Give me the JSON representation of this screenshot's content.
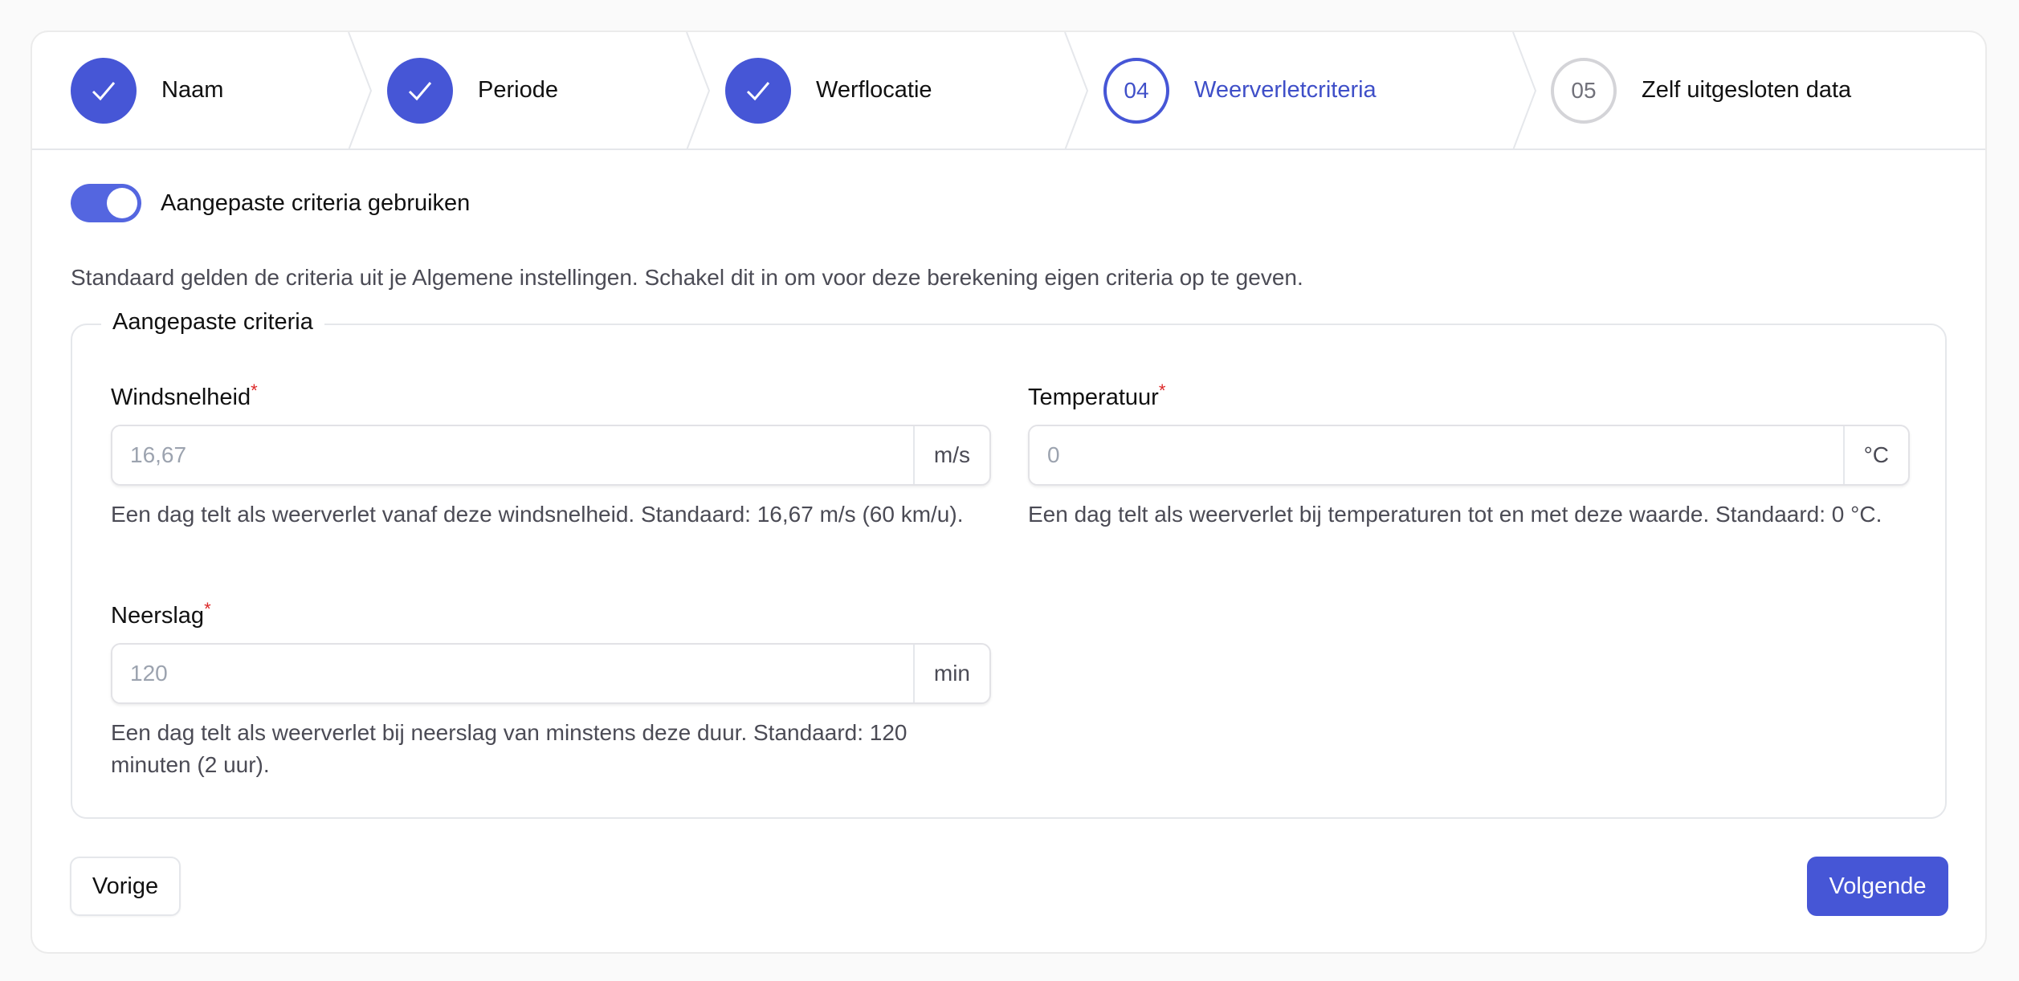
{
  "stepper": {
    "steps": [
      {
        "label": "Naam",
        "number": "",
        "state": "done",
        "icon": "check-icon"
      },
      {
        "label": "Periode",
        "number": "",
        "state": "done",
        "icon": "check-icon"
      },
      {
        "label": "Werflocatie",
        "number": "",
        "state": "done",
        "icon": "check-icon"
      },
      {
        "label": "Weerverletcriteria",
        "number": "04",
        "state": "current"
      },
      {
        "label": "Zelf uitgesloten data",
        "number": "05",
        "state": "upcoming"
      }
    ]
  },
  "toggle": {
    "label": "Aangepaste criteria gebruiken",
    "checked": true
  },
  "help_text": "Standaard gelden de criteria uit je Algemene instellingen. Schakel dit in om voor deze berekening eigen criteria op te geven.",
  "criteria": {
    "legend": "Aangepaste criteria",
    "required_marker": "*",
    "wind": {
      "label": "Windsnelheid",
      "value": "",
      "placeholder": "16,67",
      "unit": "m/s",
      "help": "Een dag telt als weerverlet vanaf deze windsnelheid. Standaard: 16,67 m/s (60 km/u)."
    },
    "temperature": {
      "label": "Temperatuur",
      "value": "",
      "placeholder": "0",
      "unit": "°C",
      "help": "Een dag telt als weerverlet bij temperaturen tot en met deze waarde. Standaard: 0 °C."
    },
    "precipitation": {
      "label": "Neerslag",
      "value": "",
      "placeholder": "120",
      "unit": "min",
      "help": "Een dag telt als weerverlet bij neerslag van minstens deze duur. Standaard: 120 minuten (2 uur)."
    }
  },
  "footer": {
    "prev_label": "Vorige",
    "next_label": "Volgende"
  },
  "colors": {
    "accent": "#4656d6",
    "accent_text": "#3f4fc8",
    "toggle_on": "#5466e0",
    "required": "#dc2626"
  }
}
